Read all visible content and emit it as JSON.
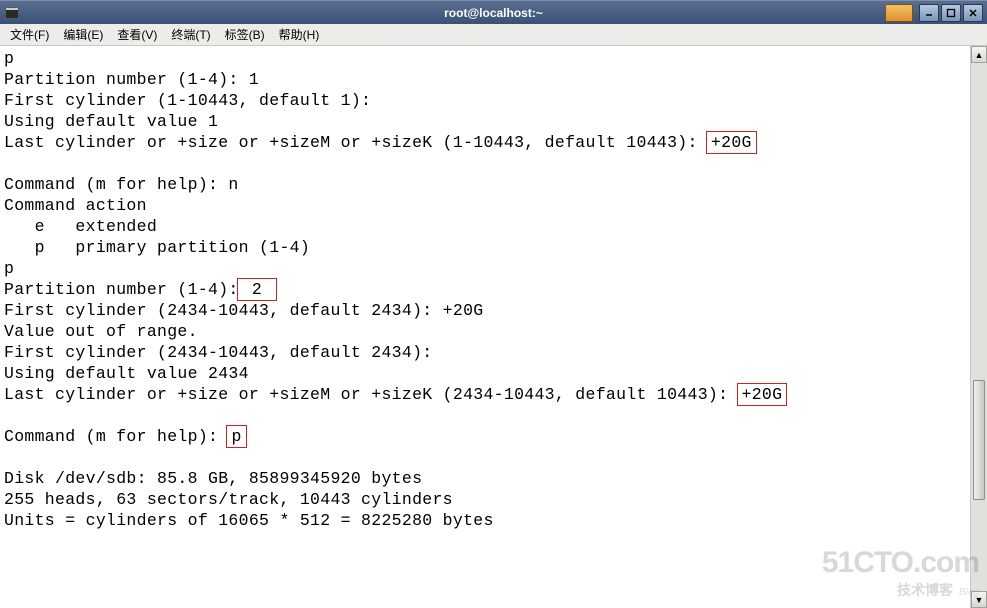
{
  "window": {
    "title": "root@localhost:~"
  },
  "menu": {
    "file": "文件(F)",
    "edit": "编辑(E)",
    "view": "查看(V)",
    "terminal": "终端(T)",
    "tabs": "标签(B)",
    "help": "帮助(H)"
  },
  "terminal": {
    "l01": "p",
    "l02": "Partition number (1-4): 1",
    "l03": "First cylinder (1-10443, default 1):",
    "l04": "Using default value 1",
    "l05a": "Last cylinder or +size or +sizeM or +sizeK (1-10443, default 10443): ",
    "l05b": "+20G",
    "l06": "",
    "l07": "Command (m for help): n",
    "l08": "Command action",
    "l09": "   e   extended",
    "l10": "   p   primary partition (1-4)",
    "l11": "p",
    "l12a": "Partition number (1-4):",
    "l12b": " 2 ",
    "l13": "First cylinder (2434-10443, default 2434): +20G",
    "l14": "Value out of range.",
    "l15": "First cylinder (2434-10443, default 2434):",
    "l16": "Using default value 2434",
    "l17a": "Last cylinder or +size or +sizeM or +sizeK (2434-10443, default 10443): ",
    "l17b": "+20G",
    "l18": "",
    "l19a": "Command (m for help): ",
    "l19b": "p",
    "l20": "",
    "l21": "Disk /dev/sdb: 85.8 GB, 85899345920 bytes",
    "l22": "255 heads, 63 sectors/track, 10443 cylinders",
    "l23": "Units = cylinders of 16065 * 512 = 8225280 bytes"
  },
  "watermark": {
    "big": "51CTO.com",
    "small": "技术博客",
    "blog": "Blog"
  }
}
